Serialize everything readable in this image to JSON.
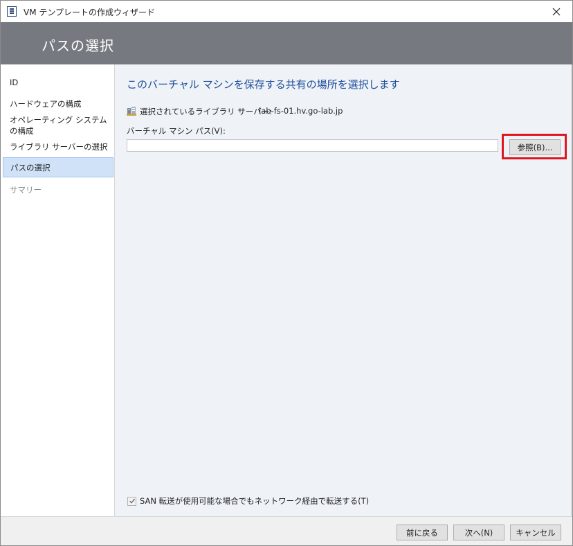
{
  "window": {
    "title": "VM テンプレートの作成ウィザード"
  },
  "header": {
    "title": "パスの選択"
  },
  "sidebar": {
    "items": [
      {
        "label": "ID",
        "state": "normal"
      },
      {
        "label": "ハードウェアの構成",
        "state": "normal"
      },
      {
        "label": "オペレーティング システムの構成",
        "state": "normal"
      },
      {
        "label": "ライブラリ サーバーの選択",
        "state": "normal"
      },
      {
        "label": "パスの選択",
        "state": "active"
      },
      {
        "label": "サマリー",
        "state": "disabled"
      }
    ]
  },
  "main": {
    "heading": "このバーチャル マシンを保存する共有の場所を選択します",
    "library_label": "選択されているライブラリ サーバー:",
    "library_value": "lab-fs-01.hv.go-lab.jp",
    "path_label": "バーチャル マシン パス(V):",
    "path_value": "",
    "browse_label": "参照(B)...",
    "san_checkbox_label": "SAN 転送が使用可能な場合でもネットワーク経由で転送する(T)",
    "san_checked": true
  },
  "footer": {
    "back_label": "前に戻る",
    "next_label": "次へ(N)",
    "cancel_label": "キャンセル"
  },
  "colors": {
    "header_band": "#767a80",
    "heading_blue": "#1f4e9a",
    "highlight_red": "#e0161e",
    "active_nav": "#cfe2f8"
  }
}
